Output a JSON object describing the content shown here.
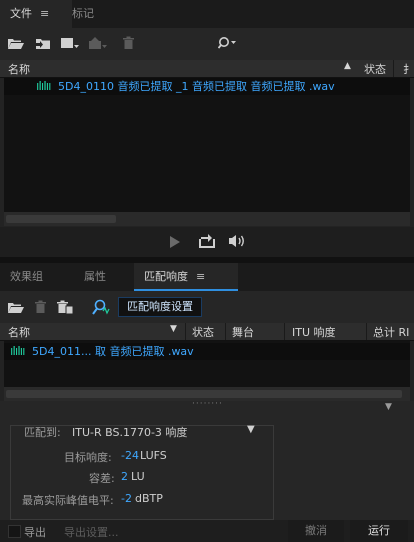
{
  "top_panel": {
    "tabs": [
      {
        "label": "文件",
        "menu": "≡"
      },
      {
        "label": "标记"
      }
    ],
    "search_icon": "search-icon",
    "columns": {
      "name": "名称",
      "status": "状态",
      "extra": "扌"
    },
    "files": [
      {
        "name": "5D4_0110 音频已提取 _1 音频已提取 音频已提取 .wav",
        "icon": "waveform-icon"
      }
    ]
  },
  "bottom_panel": {
    "tabs": [
      {
        "label": "效果组"
      },
      {
        "label": "属性"
      },
      {
        "label": "匹配响度",
        "menu": "≡"
      }
    ],
    "settings_button": "匹配响度设置",
    "columns": {
      "name": "名称",
      "status": "状态",
      "stage": "舞台",
      "itu": "ITU 响度",
      "total": "总计 RI"
    },
    "files": [
      {
        "name": "5D4_011... 取 音频已提取 .wav",
        "icon": "waveform-icon"
      }
    ],
    "settings": {
      "match_label": "匹配到:",
      "match_value": "ITU-R BS.1770-3 响度",
      "target_label": "目标响度:",
      "target_value": "-24",
      "target_unit": "LUFS",
      "tolerance_label": "容差:",
      "tolerance_value": "2",
      "tolerance_unit": "LU",
      "peak_label": "最高实际峰值电平:",
      "peak_value": "-2",
      "peak_unit": "dBTP"
    }
  },
  "footer": {
    "export_label": "导出",
    "export_settings_label": "导出设置...",
    "undo_label": "撤消",
    "run_label": "运行"
  },
  "colors": {
    "accent": "#3fa8ff",
    "wave": "#1fcfa0",
    "tab_underline": "#2f8fe0"
  }
}
